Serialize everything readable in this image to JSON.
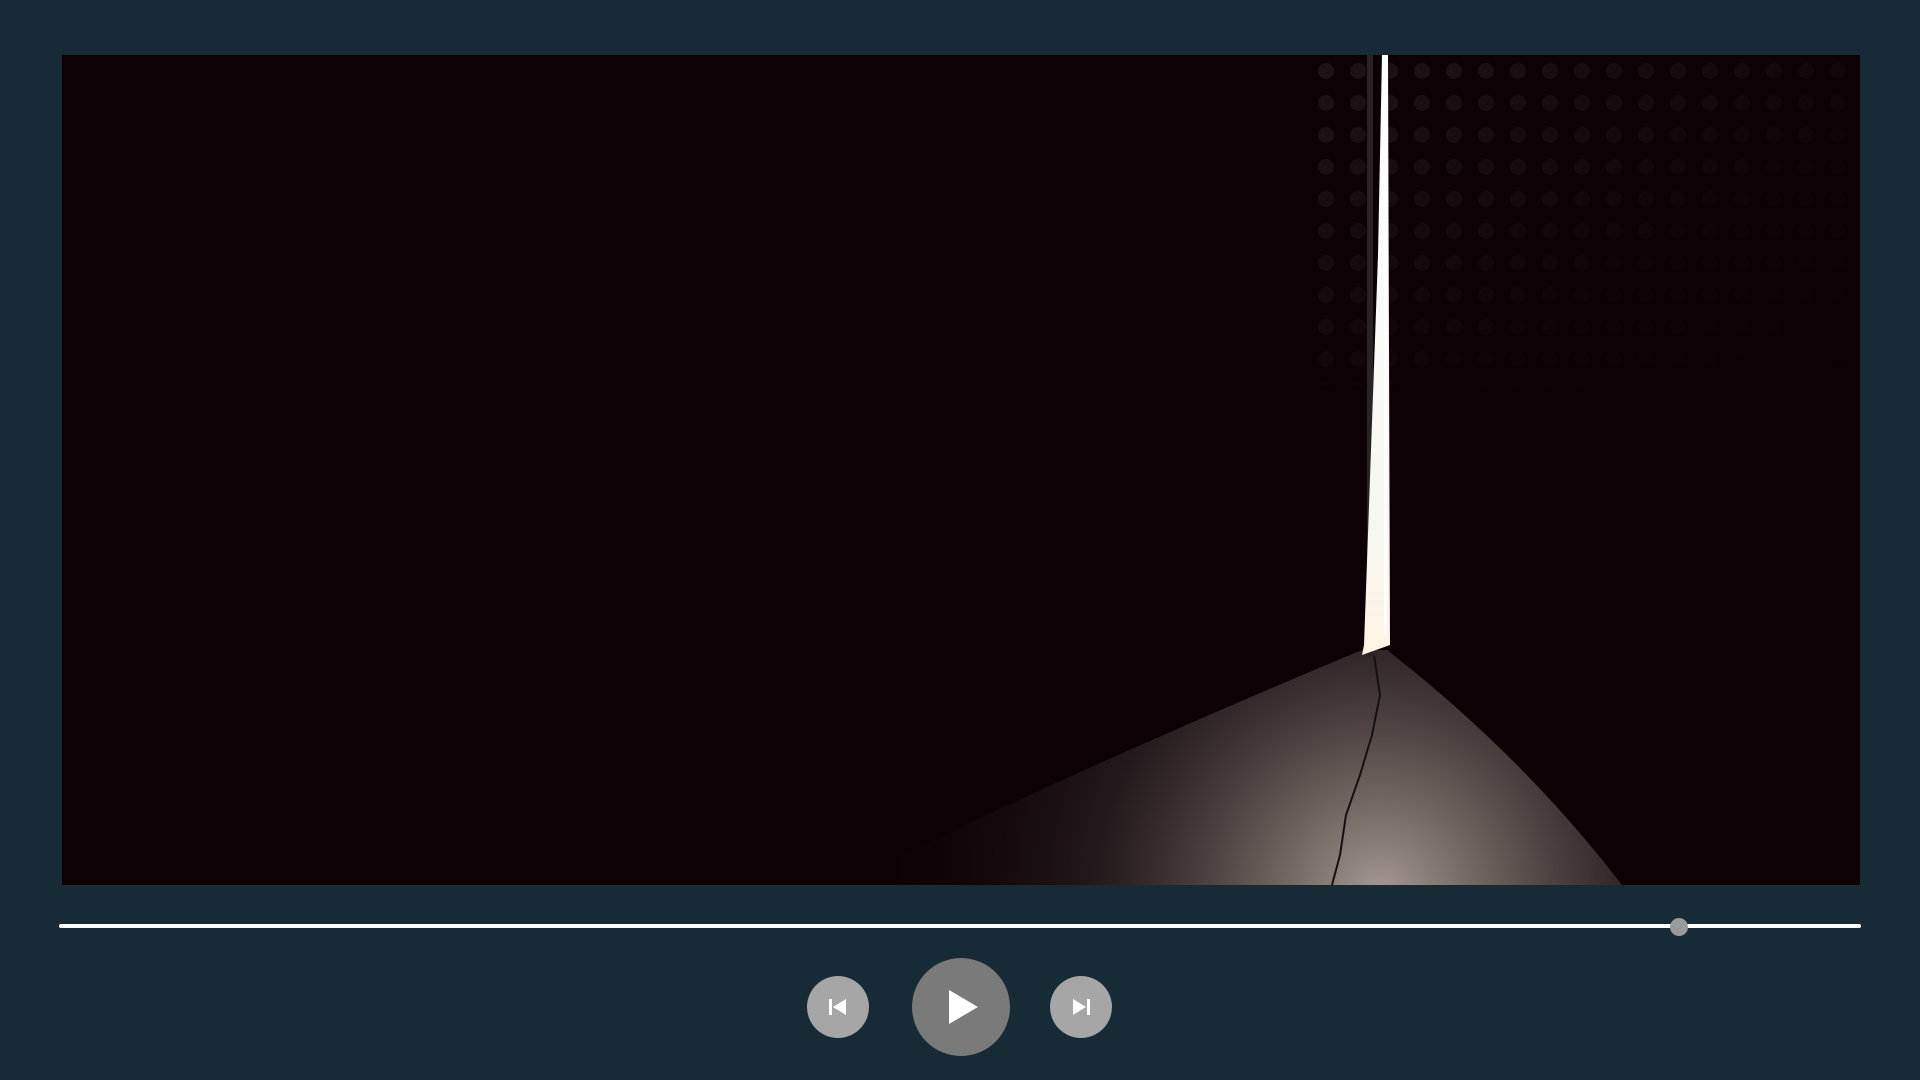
{
  "player": {
    "video": {
      "scene": "dark-room-light-beam"
    },
    "progress": {
      "fraction": 0.899
    },
    "controls": {
      "previous_icon": "skip-previous-icon",
      "play_icon": "play-icon",
      "next_icon": "skip-next-icon"
    },
    "colors": {
      "background": "#162b36",
      "video_dark": "#0c0206",
      "track": "#ffffff",
      "thumb": "#9a9a9a",
      "small_button": "#a6a6a6",
      "play_button": "#7a7a7a"
    }
  }
}
